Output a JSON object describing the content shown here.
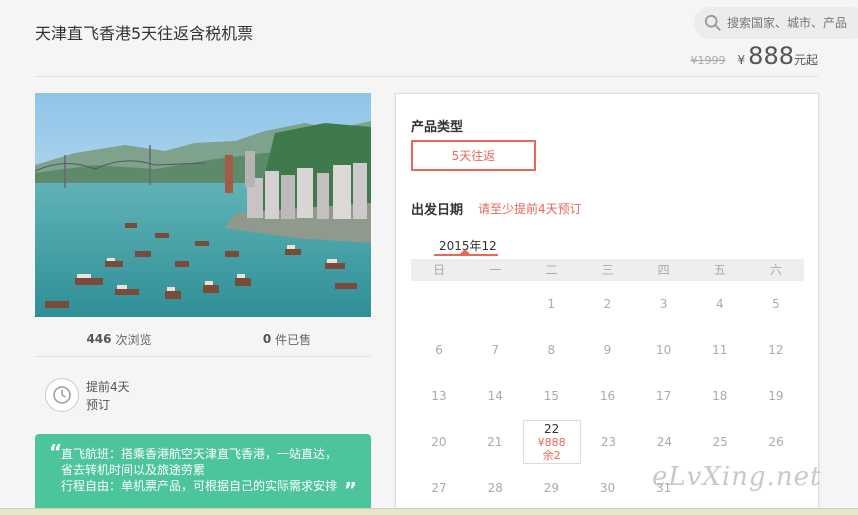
{
  "header": {
    "title": "天津直飞香港5天往返含税机票",
    "search_placeholder": "搜索国家、城市、产品"
  },
  "price": {
    "old": "¥1999",
    "currency": "¥",
    "current": "888",
    "unit": "元起"
  },
  "stats": {
    "views_count": "446",
    "views_label": "次浏览",
    "sold_count": "0",
    "sold_label": "件已售"
  },
  "advance": {
    "line1": "提前4天",
    "line2": "预订"
  },
  "highlights": [
    "直飞航班：搭乘香港航空天津直飞香港，一站直达，",
    "省去转机时间以及旅途劳累",
    "行程自由：单机票产品，可根据自己的实际需求安排"
  ],
  "booking": {
    "type_label": "产品类型",
    "type_option": "5天往返",
    "date_label": "出发日期",
    "date_note": "请至少提前4天预订",
    "month": "2015年12",
    "weekdays": [
      "日",
      "一",
      "二",
      "三",
      "四",
      "五",
      "六"
    ],
    "weeks": [
      [
        "",
        "",
        "1",
        "2",
        "3",
        "4",
        "5"
      ],
      [
        "6",
        "7",
        "8",
        "9",
        "10",
        "11",
        "12"
      ],
      [
        "13",
        "14",
        "15",
        "16",
        "17",
        "18",
        "19"
      ],
      [
        "20",
        "21",
        "22",
        "23",
        "24",
        "25",
        "26"
      ],
      [
        "27",
        "28",
        "29",
        "30",
        "31",
        "",
        ""
      ]
    ],
    "available": {
      "day": "22",
      "price": "¥888",
      "left": "余2"
    }
  },
  "watermark": "eLvXing.net",
  "colors": {
    "accent": "#e8685a",
    "green": "#4dc59a"
  }
}
